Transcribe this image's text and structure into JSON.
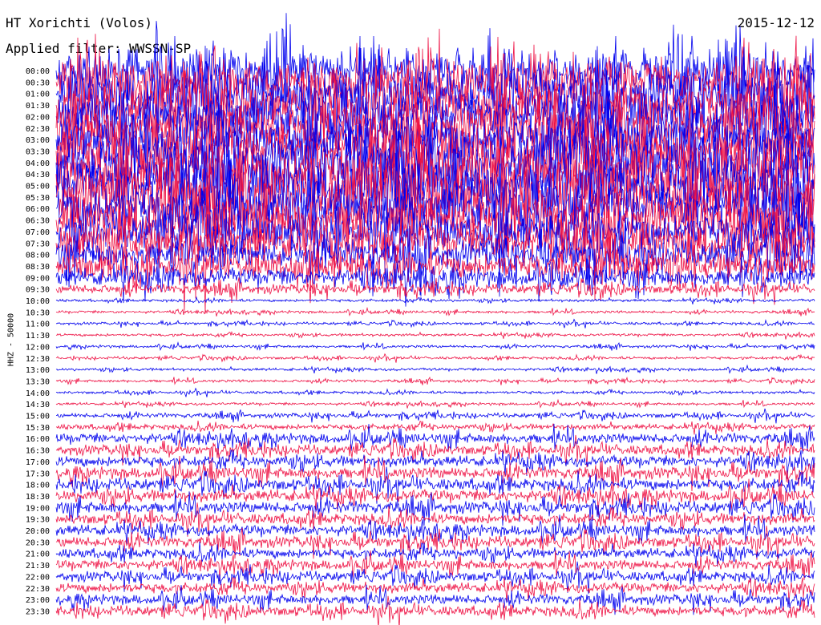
{
  "header": {
    "station": "HT Xorichti (Volos)",
    "date": "2015-12-12",
    "filter": "Applied filter: WWSSN-SP"
  },
  "chart_data": {
    "type": "line",
    "ylabel": "HHZ - 50000",
    "rows": [
      "00:00",
      "00:30",
      "01:00",
      "01:30",
      "02:00",
      "02:30",
      "03:00",
      "03:30",
      "04:00",
      "04:30",
      "05:00",
      "05:30",
      "06:00",
      "06:30",
      "07:00",
      "07:30",
      "08:00",
      "08:30",
      "09:00",
      "09:30",
      "10:00",
      "10:30",
      "11:00",
      "11:30",
      "12:00",
      "12:30",
      "13:00",
      "13:30",
      "14:00",
      "14:30",
      "15:00",
      "15:30",
      "16:00",
      "16:30",
      "17:00",
      "17:30",
      "18:00",
      "18:30",
      "19:00",
      "19:30",
      "20:00",
      "20:30",
      "21:00",
      "21:30",
      "22:00",
      "22:30",
      "23:00",
      "23:30"
    ],
    "trace_colors": [
      "#0000ee",
      "#ee1144"
    ],
    "noise_level": [
      5,
      5,
      5,
      5,
      5,
      5,
      5,
      5,
      6,
      6,
      6,
      6,
      5,
      5,
      4,
      4,
      3,
      3,
      2,
      1,
      0.3,
      0.3,
      0.3,
      0.3,
      0.3,
      0.3,
      0.3,
      0.3,
      0.3,
      0.3,
      0.5,
      0.6,
      1.1,
      1.1,
      1.2,
      1.3,
      1.3,
      1.3,
      1.3,
      1.2,
      1.2,
      1.2,
      1.1,
      1.1,
      1.1,
      1.1,
      1.1,
      1.1
    ]
  }
}
